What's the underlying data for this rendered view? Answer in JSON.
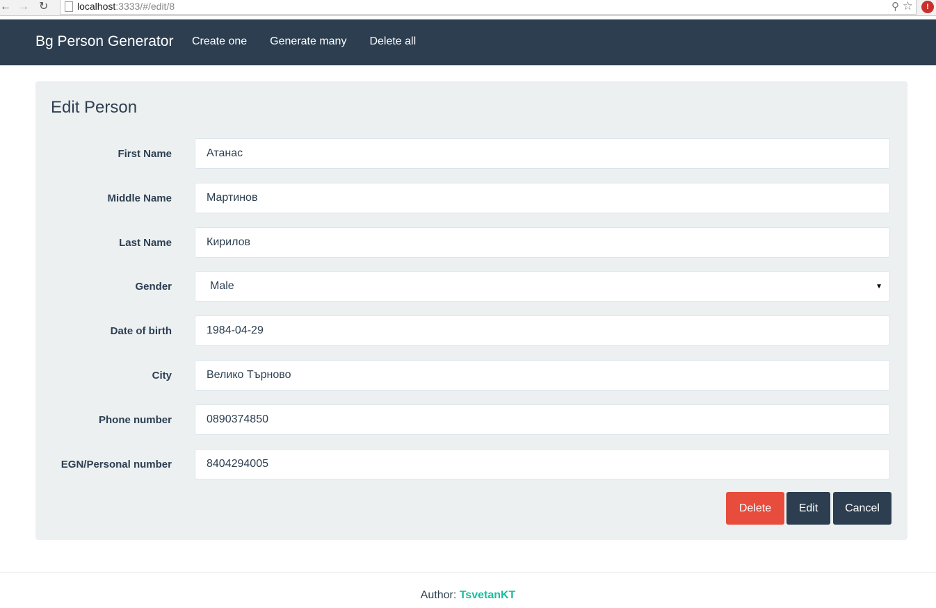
{
  "browser": {
    "url_host": "localhost",
    "url_rest": ":3333/#/edit/8",
    "ext_label": "!"
  },
  "navbar": {
    "brand": "Bg Person Generator",
    "links": [
      "Create one",
      "Generate many",
      "Delete all"
    ]
  },
  "panel": {
    "title": "Edit Person",
    "fields": [
      {
        "label": "First Name",
        "value": "Атанас"
      },
      {
        "label": "Middle Name",
        "value": "Мартинов"
      },
      {
        "label": "Last Name",
        "value": "Кирилов"
      },
      {
        "label": "Gender",
        "value": "Male"
      },
      {
        "label": "Date of birth",
        "value": "1984-04-29"
      },
      {
        "label": "City",
        "value": "Велико Търново"
      },
      {
        "label": "Phone number",
        "value": "0890374850"
      },
      {
        "label": "EGN/Personal number",
        "value": "8404294005"
      }
    ],
    "buttons": {
      "delete": "Delete",
      "edit": "Edit",
      "cancel": "Cancel"
    }
  },
  "footer": {
    "prefix": "Author: ",
    "author": "TsvetanKT"
  },
  "colors": {
    "navbar": "#2c3e50",
    "panel": "#ecf0f1",
    "danger": "#e74c3c",
    "link": "#18bc9c"
  }
}
